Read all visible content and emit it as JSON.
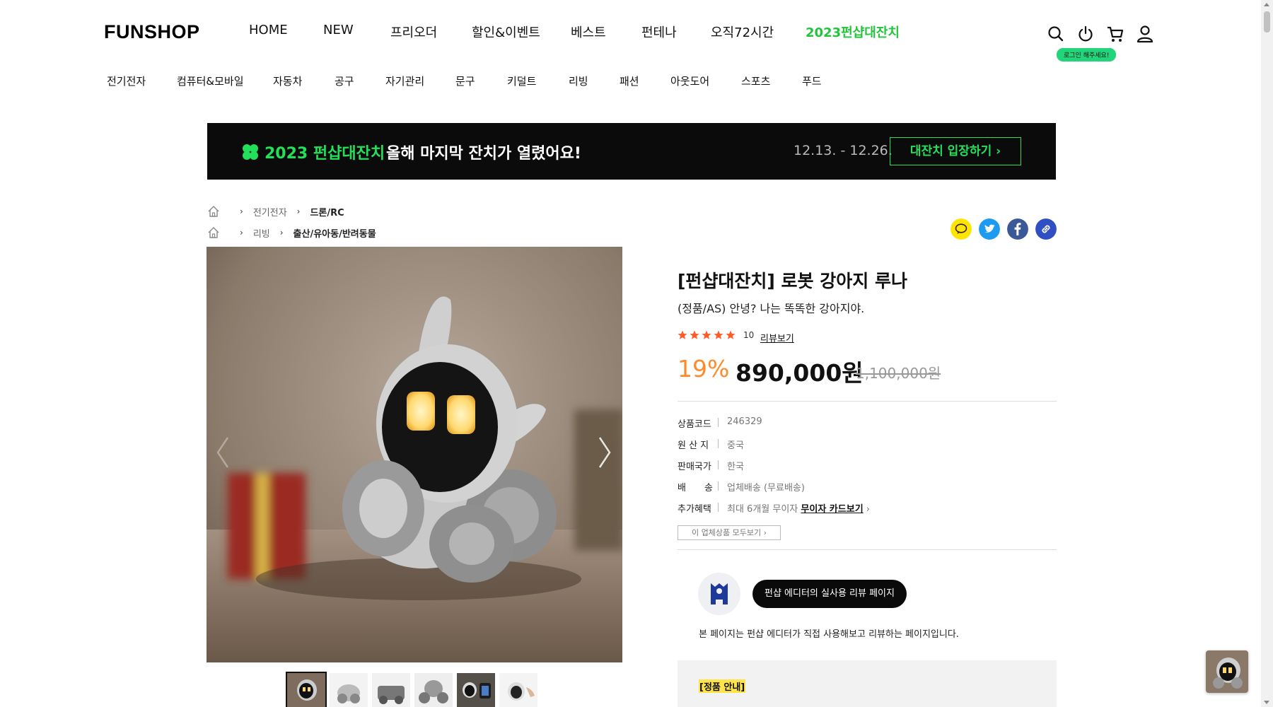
{
  "header": {
    "logo": "FUNSHOP",
    "nav": [
      "HOME",
      "NEW",
      "프리오더",
      "할인&이벤트",
      "베스트",
      "펀테나",
      "오직72시간",
      "2023펀샵대잔치"
    ],
    "highlight_color": "#22c43a",
    "icons": [
      "search-icon",
      "power-icon",
      "cart-icon",
      "user-icon"
    ],
    "login_tip": "로그인 해주세요!"
  },
  "categories": [
    "전기전자",
    "컴퓨터&모바일",
    "자동차",
    "공구",
    "자기관리",
    "문구",
    "키덜트",
    "리빙",
    "패션",
    "아웃도어",
    "스포츠",
    "푸드"
  ],
  "banner": {
    "title": "2023 펀샵대잔치",
    "subtitle": "올해 마지막 잔치가 열렸어요!",
    "date": "12.13. - 12.26.",
    "button": "대잔치 입장하기 ›",
    "accent": "#22e05a"
  },
  "breadcrumbs": [
    {
      "first": "전기전자",
      "last": "드론/RC"
    },
    {
      "first": "리빙",
      "last": "출산/유아동/반려동물"
    }
  ],
  "share": {
    "icons": [
      "kakaotalk-icon",
      "twitter-icon",
      "facebook-icon",
      "link-icon"
    ]
  },
  "product": {
    "title": "[펀샵대잔치] 로봇 강아지 루나",
    "subtitle": "(정품/AS) 안녕? 나는 똑똑한 강아지야.",
    "rating_stars": 5,
    "review_count": "10",
    "review_link": "리뷰보기",
    "discount": "19%",
    "price": "890,000원",
    "original_price": "1,100,000원",
    "specs": [
      {
        "key": "상품코드",
        "value": "246329"
      },
      {
        "key": "원 산 지",
        "value": "중국"
      },
      {
        "key": "판매국가",
        "value": "한국"
      },
      {
        "key": "배　　송",
        "value": "업체배송 (무료배송)"
      },
      {
        "key": "추가혜택",
        "value": "최대 6개월 무이자",
        "link": "무이자 카드보기"
      }
    ],
    "all_products_button": "이 업체상품 모두보기",
    "thumbnail_count": 6
  },
  "editor": {
    "pill": "펀샵 에디터의 실사용 리뷰 페이지",
    "description": "본 페이지는 펀샵 에디터가 직접 사용해보고 리뷰하는 페이지입니다."
  },
  "notice": {
    "title": "[정품 안내]"
  }
}
